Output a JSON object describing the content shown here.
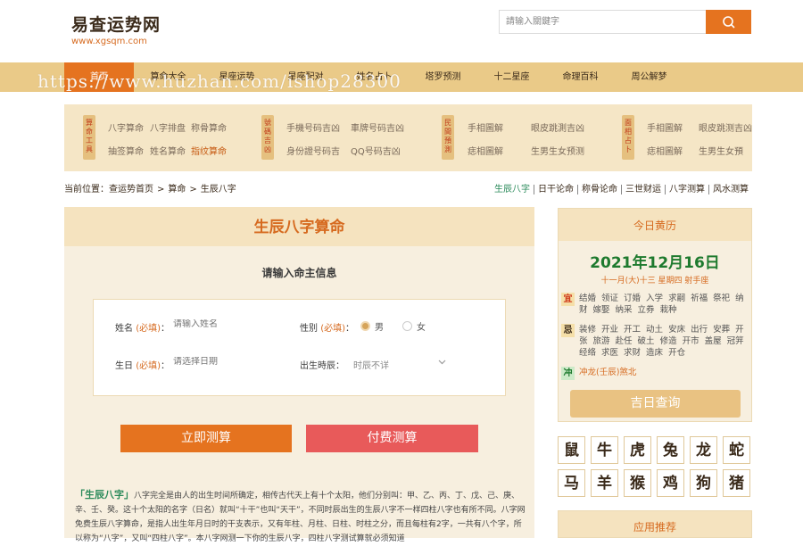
{
  "header": {
    "logo_name": "易查运势网",
    "logo_url": "www.xgsqm.com",
    "search_placeholder": "請输入關鍵字"
  },
  "nav": [
    "首页",
    "算命大全",
    "星座运势",
    "星座配对",
    "姓名占卜",
    "塔罗预测",
    "十二星座",
    "命理百科",
    "周公解梦"
  ],
  "watermark": "https://www.huzhan.com/ishop28300",
  "tools": {
    "groups": [
      {
        "tag": "算命工具",
        "links": [
          "八字算命",
          "八字排盘",
          "称骨算命",
          "抽签算命",
          "姓名算命",
          "指纹算命"
        ]
      },
      {
        "tag": "號碼吉凶",
        "links": [
          "手機号码吉凶",
          "車牌号码吉凶",
          "身份證号码吉",
          "QQ号码吉凶"
        ]
      },
      {
        "tag": "民間預測",
        "links": [
          "手相圖解",
          "眼皮跳測吉凶",
          "痣相圖解",
          "生男生女预测"
        ]
      },
      {
        "tag": "面相占卜",
        "links": [
          "手相圖解",
          "眼皮跳测吉凶",
          "痣相圖解",
          "生男生女預"
        ]
      }
    ]
  },
  "breadcrumb": {
    "prefix": "当前位置：",
    "items": [
      "查运势首页",
      "算命",
      "生辰八字"
    ]
  },
  "quick_links": [
    "生辰八字",
    "日干论命",
    "称骨论命",
    "三世财运",
    "八字测算",
    "风水测算"
  ],
  "main": {
    "title": "生辰八字算命",
    "subtitle": "请输入命主信息",
    "name_label": "姓名",
    "required": "(必填)",
    "colon": "：",
    "name_placeholder": "请输入姓名",
    "gender_label": "性别",
    "gender_male": "男",
    "gender_female": "女",
    "birthday_label": "生日",
    "birthday_placeholder": "请选择日期",
    "hour_label": "出生時辰：",
    "hour_value": "时辰不详",
    "btn_free": "立即测算",
    "btn_paid": "付费测算",
    "desc_keyword": "「生辰八字」",
    "desc_text": "八字完全是由人的出生时间所确定，相传古代天上有十个太阳，他们分别叫：甲、乙、丙、丁、戊、己、庚、辛、壬、癸。这十个太阳的名字（日名）就叫“十干”也叫“天干”，不同时辰出生的生辰八字不一样四柱八字也有所不同。八字网免费生辰八字算命，是指人出生年月日时的干支表示，又有年柱、月柱、日柱、时柱之分，而且每柱有2字，一共有八个字，所以称为“八字”，又叫“四柱八字”。本八字网测一下你的生辰八字，四柱八字测试算就必须知道"
  },
  "calendar": {
    "head": "今日黄历",
    "date": "2021年12月16日",
    "lunar": "十一月(大)十三 星期四 射手座",
    "yi_tag": "宜",
    "yi": "结婚 领证 订婚 入学 求嗣 祈福 祭祀 纳财 嫁娶 纳采 立券 栽种",
    "ji_tag": "忌",
    "ji": "装修 开业 开工 动土 安床 出行 安葬 开张 旅游 赴任 破土 修造 开市 盖屋 冠笄 经络 求医 求财 造床 开仓",
    "chong_tag": "冲",
    "chong": "冲龙(壬辰)煞北",
    "button": "吉日查询"
  },
  "zodiac": [
    "鼠",
    "牛",
    "虎",
    "兔",
    "龙",
    "蛇",
    "马",
    "羊",
    "猴",
    "鸡",
    "狗",
    "猪"
  ],
  "apps_title": "应用推荐",
  "colors": {
    "accent": "#e5731f",
    "nav_bg": "#eaca88",
    "paid_button": "#e85a5a",
    "calendar_date": "#1e7a2e"
  }
}
